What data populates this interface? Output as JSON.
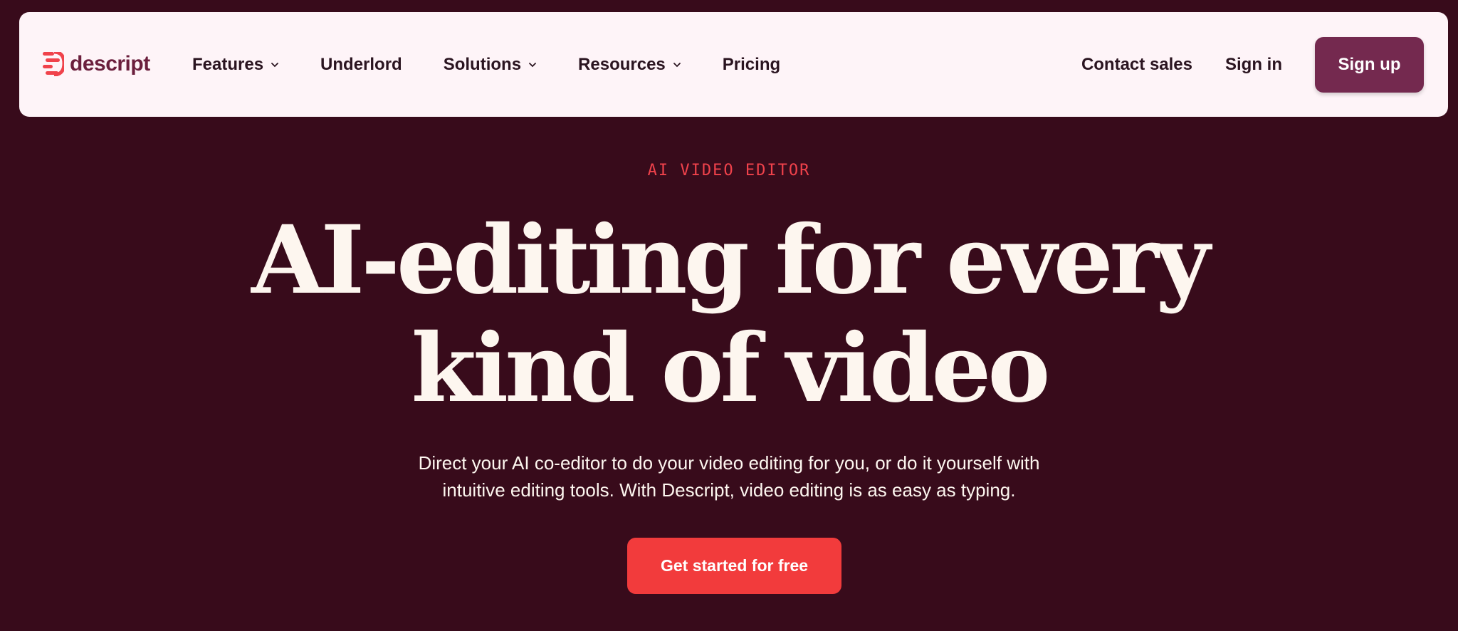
{
  "nav": {
    "logo_text": "descript",
    "links": [
      {
        "label": "Features",
        "has_dropdown": true
      },
      {
        "label": "Underlord",
        "has_dropdown": false
      },
      {
        "label": "Solutions",
        "has_dropdown": true
      },
      {
        "label": "Resources",
        "has_dropdown": true
      },
      {
        "label": "Pricing",
        "has_dropdown": false
      }
    ],
    "contact_sales": "Contact sales",
    "sign_in": "Sign in",
    "sign_up": "Sign up"
  },
  "hero": {
    "eyebrow": "AI VIDEO EDITOR",
    "headline_line1": "AI-editing for every",
    "headline_line2": "kind of video",
    "subtext_line1": "Direct your AI co-editor to do your video editing for you, or do it yourself with",
    "subtext_line2": "intuitive editing tools. With Descript, video editing is as easy as typing.",
    "cta": "Get started for free"
  },
  "colors": {
    "page_background": "#380b1b",
    "nav_background": "#fef4f8",
    "brand": "#6b1f3d",
    "logo_accent": "#f0424b",
    "sign_up_button": "#74294f",
    "cta_button": "#f23b3c",
    "headline_text": "#fdf6ef"
  },
  "icons": {
    "logo": "descript-logo-icon",
    "dropdown": "chevron-down-icon"
  }
}
